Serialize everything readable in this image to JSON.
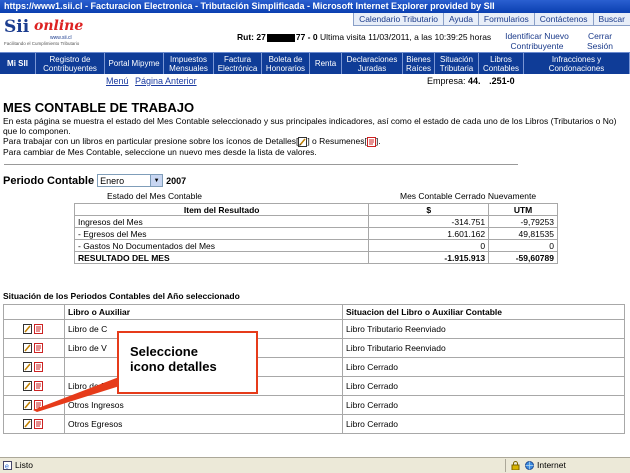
{
  "window": {
    "title": "https://www1.sii.cl - Facturacion Electronica - Tributación Simplificada - Microsoft Internet Explorer provided by SII"
  },
  "topnav": [
    "Calendario Tributario",
    "Ayuda",
    "Formularios",
    "Contáctenos",
    "Buscar"
  ],
  "logo": {
    "brand1": "Sii",
    "brand2": "online",
    "url": "www.sii.cl",
    "tagline": "Facilitando el Cumplimiento Tributario"
  },
  "header": {
    "rut_label": "Rut:",
    "rut_start": "27",
    "rut_end": "77 - 0",
    "ultima_visita": "Ultima visita 11/03/2011, a las 10:39:25 horas",
    "identificar": "Identificar Nuevo Contribuyente",
    "cerrar": "Cerrar Sesión"
  },
  "mainnav": [
    "Mi SII",
    "Registro de Contribuyentes",
    "Portal Mipyme",
    "Impuestos Mensuales",
    "Factura Electrónica",
    "Boleta de Honorarios",
    "Renta",
    "Declaraciones Juradas",
    "Bienes Raíces",
    "Situación Tributaria",
    "Libros Contables",
    "Infracciones y Condonaciones"
  ],
  "submenu": {
    "menu": "Menú",
    "anterior": "Página Anterior"
  },
  "empresa": {
    "label": "Empresa:",
    "value1": "44.",
    "value2": ".251-0"
  },
  "page": {
    "title": "MES CONTABLE DE TRABAJO",
    "desc1": "En esta página se muestra el estado del Mes Contable seleccionado y sus principales indicadores, así como el estado de cada uno de los Libros (Tributarios o No) que lo componen.",
    "desc2a": "Para trabajar con un libros en particular presione sobre los íconos de Detalles[",
    "desc2b": "] o Resumenes[",
    "desc2c": "].",
    "desc3": "Para cambiar de Mes Contable, seleccione un nuevo mes desde la lista de valores."
  },
  "periodo": {
    "label": "Periodo Contable",
    "mes": "Enero",
    "anio": "2007"
  },
  "estado": {
    "label": "Estado del Mes Contable",
    "value": "Mes Contable Cerrado Nuevamente"
  },
  "resultados": {
    "headers": [
      "Item del Resultado",
      "$",
      "UTM"
    ],
    "rows": [
      {
        "item": "Ingresos del Mes",
        "pesos": "-314.751",
        "utm": "-9,79253"
      },
      {
        "item": "- Egresos del Mes",
        "pesos": "1.601.162",
        "utm": "49,81535"
      },
      {
        "item": "- Gastos No Documentados del Mes",
        "pesos": "0",
        "utm": "0"
      }
    ],
    "total": {
      "item": "RESULTADO DEL MES",
      "pesos": "-1.915.913",
      "utm": "-59,60789"
    }
  },
  "situacion": {
    "title": "Situación de los Periodos Contables del Año seleccionado",
    "headers": [
      "Libro o Auxiliar",
      "Situacion del Libro o Auxiliar Contable"
    ],
    "rows": [
      {
        "libro": "Libro de C",
        "situacion": "Libro Tributario Reenviado"
      },
      {
        "libro": "Libro de V",
        "situacion": "Libro Tributario Reenviado"
      },
      {
        "libro": "",
        "situacion": "Libro Cerrado"
      },
      {
        "libro": "Libro de R",
        "situacion": "Libro Cerrado"
      },
      {
        "libro": "Otros Ingresos",
        "situacion": "Libro Cerrado"
      },
      {
        "libro": "Otros Egresos",
        "situacion": "Libro Cerrado"
      }
    ]
  },
  "callout": {
    "line1": "Seleccione",
    "line2": "icono detalles"
  },
  "statusbar": {
    "status": "Listo",
    "zone": "Internet"
  }
}
